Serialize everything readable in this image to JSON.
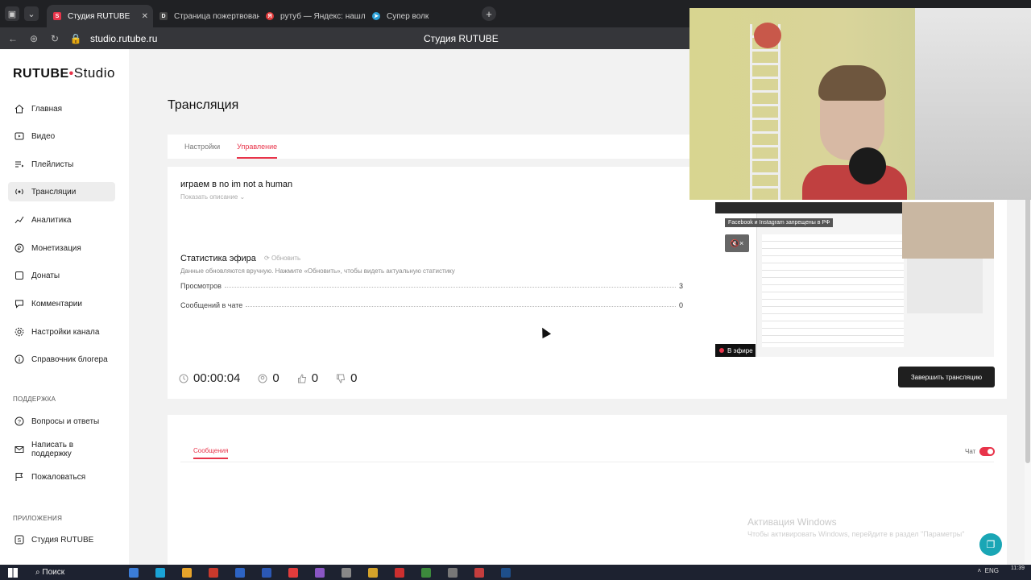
{
  "browser": {
    "tabs": [
      {
        "label": "Студия RUTUBE",
        "active": true
      },
      {
        "label": "Страница пожертвования",
        "active": false
      },
      {
        "label": "рутуб — Яндекс: нашлось",
        "active": false
      },
      {
        "label": "Супер волк",
        "active": false
      }
    ],
    "url": "studio.rutube.ru",
    "page_title": "Студия RUTUBE"
  },
  "logo": {
    "brand": "RUTUBE",
    "suffix": "Studio"
  },
  "sidebar": {
    "items": [
      {
        "label": "Главная",
        "icon": "home-icon"
      },
      {
        "label": "Видео",
        "icon": "video-icon"
      },
      {
        "label": "Плейлисты",
        "icon": "playlist-icon"
      },
      {
        "label": "Трансляции",
        "icon": "broadcast-icon",
        "active": true
      },
      {
        "label": "Аналитика",
        "icon": "analytics-icon"
      },
      {
        "label": "Монетизация",
        "icon": "money-icon"
      },
      {
        "label": "Донаты",
        "icon": "donate-icon"
      },
      {
        "label": "Комментарии",
        "icon": "comment-icon"
      },
      {
        "label": "Настройки канала",
        "icon": "gear-icon"
      },
      {
        "label": "Справочник блогера",
        "icon": "info-icon"
      }
    ],
    "support_title": "ПОДДЕРЖКА",
    "support_items": [
      {
        "label": "Вопросы и ответы",
        "icon": "question-icon"
      },
      {
        "label": "Написать в поддержку",
        "icon": "mail-icon"
      },
      {
        "label": "Пожаловаться",
        "icon": "flag-icon"
      }
    ],
    "apps_title": "ПРИЛОЖЕНИЯ",
    "apps_items": [
      {
        "label": "Студия RUTUBE",
        "icon": "studio-icon"
      }
    ]
  },
  "main": {
    "title": "Трансляция",
    "tabs": {
      "settings": "Настройки",
      "control": "Управление"
    },
    "stream_title": "играем в no im not a human",
    "show_description": "Показать описание",
    "stats_title": "Статистика эфира",
    "refresh": "Обновить",
    "note": "Данные обновляются вручную. Нажмите «Обновить», чтобы видеть актуальную статистику",
    "stats": [
      {
        "label": "Просмотров",
        "value": "3"
      },
      {
        "label": "Сообщений в чате",
        "value": "0"
      }
    ],
    "duration": "00:00:04",
    "viewers": "0",
    "likes": "0",
    "dislikes": "0",
    "end_button": "Завершить трансляцию",
    "messages_tab": "Сообщения",
    "chat_label": "Чат",
    "chat_enabled": true
  },
  "preview": {
    "banner": "Facebook и Instagram запрещены в РФ",
    "mute": "🔇×",
    "live": "В эфире"
  },
  "windows": {
    "activation_title": "Активация Windows",
    "activation_text": "Чтобы активировать Windows, перейдите в раздел \"Параметры\""
  },
  "taskbar": {
    "search": "Поиск",
    "lang": "ENG",
    "time": "11:39"
  },
  "colors": {
    "accent": "#e8344a",
    "dark_button": "#1f1f1f",
    "help": "#1aa6b5"
  }
}
